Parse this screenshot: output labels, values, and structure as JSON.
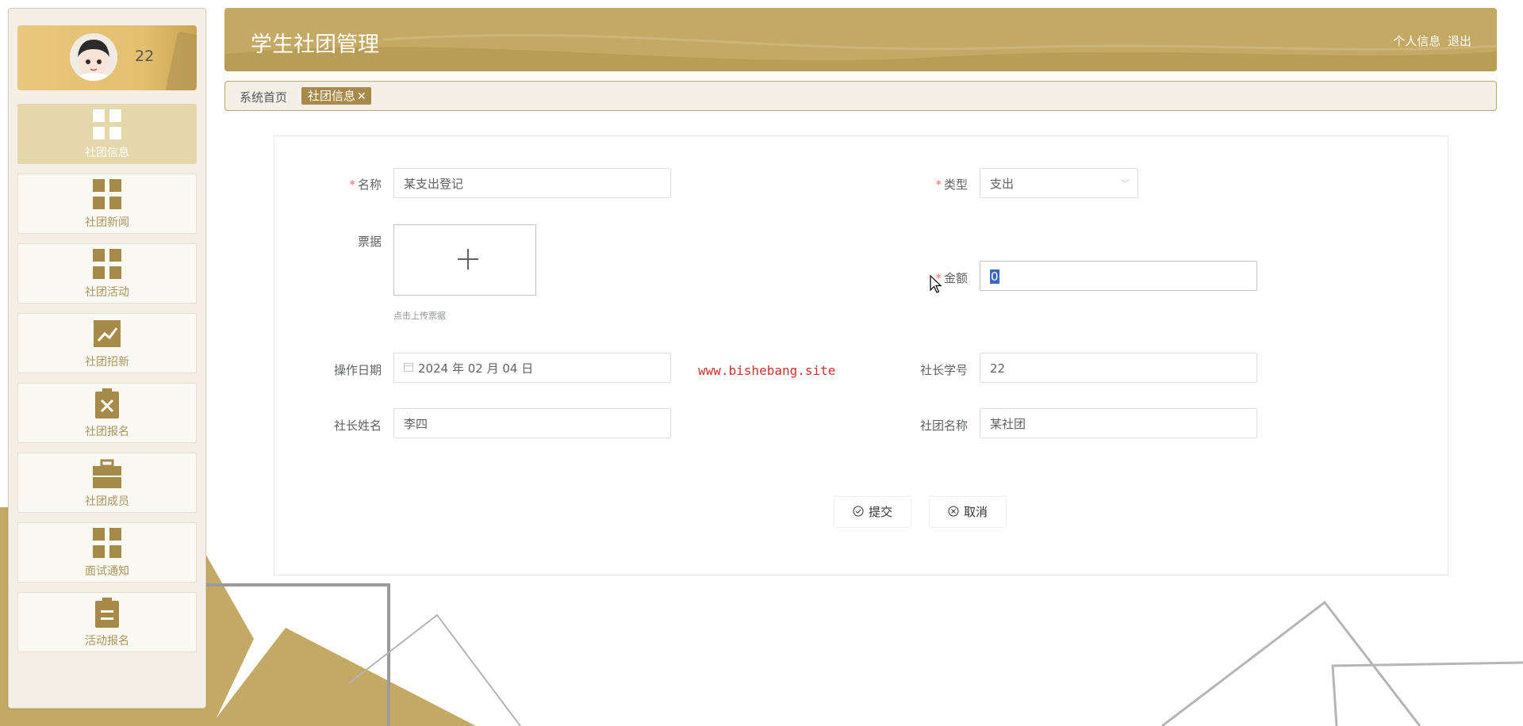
{
  "app": {
    "title": "学生社团管理"
  },
  "header": {
    "profile_link": "个人信息",
    "logout_link": "退出"
  },
  "user": {
    "name": "22"
  },
  "sidebar": {
    "items": [
      {
        "label": "社团信息",
        "icon": "grid-icon",
        "active": true
      },
      {
        "label": "社团新闻",
        "icon": "grid-icon"
      },
      {
        "label": "社团活动",
        "icon": "grid-icon"
      },
      {
        "label": "社团招新",
        "icon": "chart-icon"
      },
      {
        "label": "社团报名",
        "icon": "clipboard-x-icon"
      },
      {
        "label": "社团成员",
        "icon": "briefcase-icon"
      },
      {
        "label": "面试通知",
        "icon": "grid-icon"
      },
      {
        "label": "活动报名",
        "icon": "clipboard-list-icon"
      },
      {
        "label": "",
        "icon": "clipboard-icon"
      }
    ]
  },
  "tabs": {
    "home": "系统首页",
    "active": "社团信息",
    "close_glyph": "✕"
  },
  "form": {
    "name": {
      "label": "名称",
      "required": true,
      "value": "某支出登记"
    },
    "type": {
      "label": "类型",
      "required": true,
      "value": "支出"
    },
    "receipt": {
      "label": "票据",
      "tip": "点击上传票据"
    },
    "amount": {
      "label": "金额",
      "required": true,
      "value": "0"
    },
    "date": {
      "label": "操作日期",
      "value": "2024 年 02 月 04 日"
    },
    "leader_id": {
      "label": "社长学号",
      "value": "22"
    },
    "leader_name": {
      "label": "社长姓名",
      "value": "李四"
    },
    "club_name": {
      "label": "社团名称",
      "value": "某社团"
    },
    "submit_label": "提交",
    "cancel_label": "取消"
  },
  "watermark": "www.bishebang.site",
  "colors": {
    "accent": "#c4a965",
    "menu_text": "#a9945c",
    "active_tab": "#a7894a",
    "required": "#f56c6c"
  }
}
